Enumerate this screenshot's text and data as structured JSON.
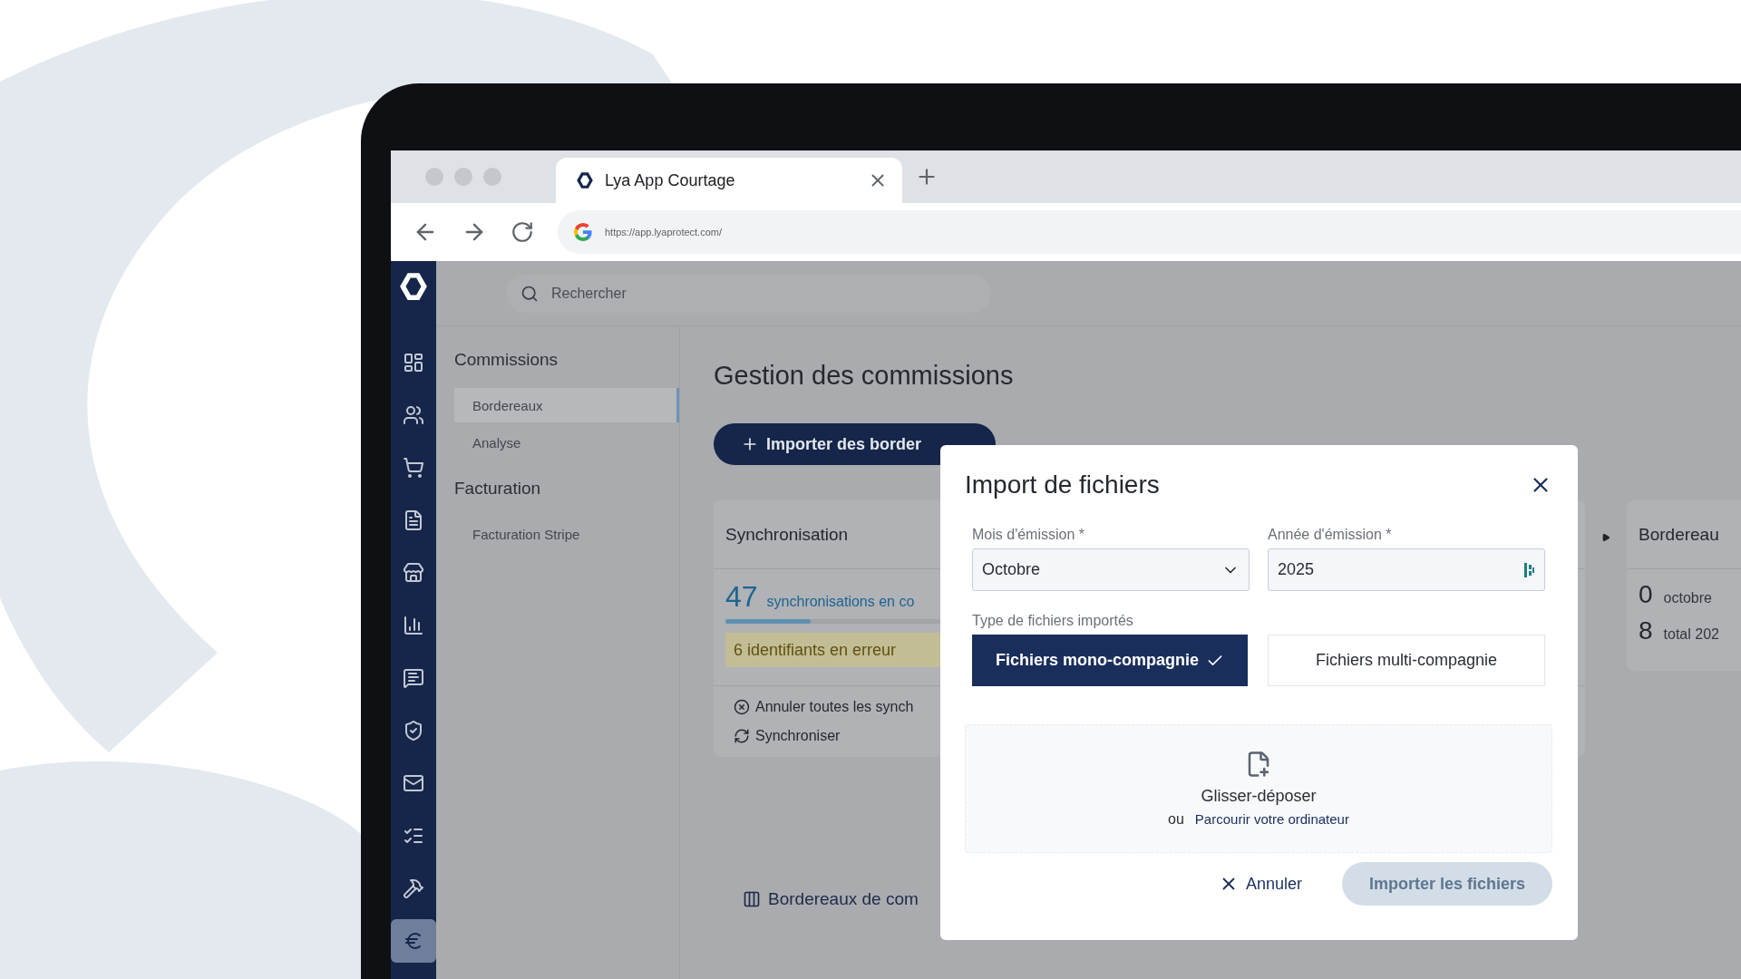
{
  "browser": {
    "tab_title": "Lya App Courtage",
    "url": "https://app.lyaprotect.com/"
  },
  "sidebar": {
    "items": [
      {
        "selected": false
      },
      {
        "selected": false
      },
      {
        "selected": false
      },
      {
        "selected": false
      },
      {
        "selected": false
      },
      {
        "selected": false
      },
      {
        "selected": false
      },
      {
        "selected": false
      },
      {
        "selected": false
      },
      {
        "selected": false
      },
      {
        "selected": false
      },
      {
        "selected": true
      }
    ]
  },
  "search": {
    "placeholder": "Rechercher"
  },
  "nav": {
    "sections": [
      {
        "title": "Commissions",
        "items": [
          {
            "label": "Bordereaux",
            "selected": true
          },
          {
            "label": "Analyse",
            "selected": false
          }
        ]
      },
      {
        "title": "Facturation",
        "items": [
          {
            "label": "Facturation Stripe",
            "selected": false
          }
        ]
      }
    ]
  },
  "page": {
    "title": "Gestion des commissions",
    "import_button": "Importer des border",
    "sync_card": {
      "title": "Synchronisation",
      "count": "47",
      "count_label": "synchronisations en co",
      "level": 0.1,
      "error": "6 identifiants en erreur",
      "actions": [
        {
          "kind": "cancel",
          "label": "Annuler toutes les synch"
        },
        {
          "kind": "sync",
          "label": "Synchroniser"
        }
      ]
    },
    "table_toggle": "Bordereaux de com",
    "side_card": {
      "title": "Bordereau",
      "stats": [
        {
          "value": "0",
          "label": "octobre"
        },
        {
          "value": "8",
          "label": "total 202"
        }
      ]
    }
  },
  "modal": {
    "title": "Import de fichiers",
    "month": {
      "label": "Mois d'émission *",
      "value": "Octobre"
    },
    "year": {
      "label": "Année d'émission *",
      "value": "2025"
    },
    "type_label": "Type de fichiers importés",
    "types": [
      {
        "label": "Fichiers mono-compagnie",
        "selected": true
      },
      {
        "label": "Fichiers multi-compagnie",
        "selected": false
      }
    ],
    "dropzone": {
      "title": "Glisser-déposer",
      "or": "ou",
      "link": "Parcourir votre ordinateur"
    },
    "cancel": "Annuler",
    "submit": {
      "label": "Importer les fichiers",
      "disabled": true
    }
  }
}
